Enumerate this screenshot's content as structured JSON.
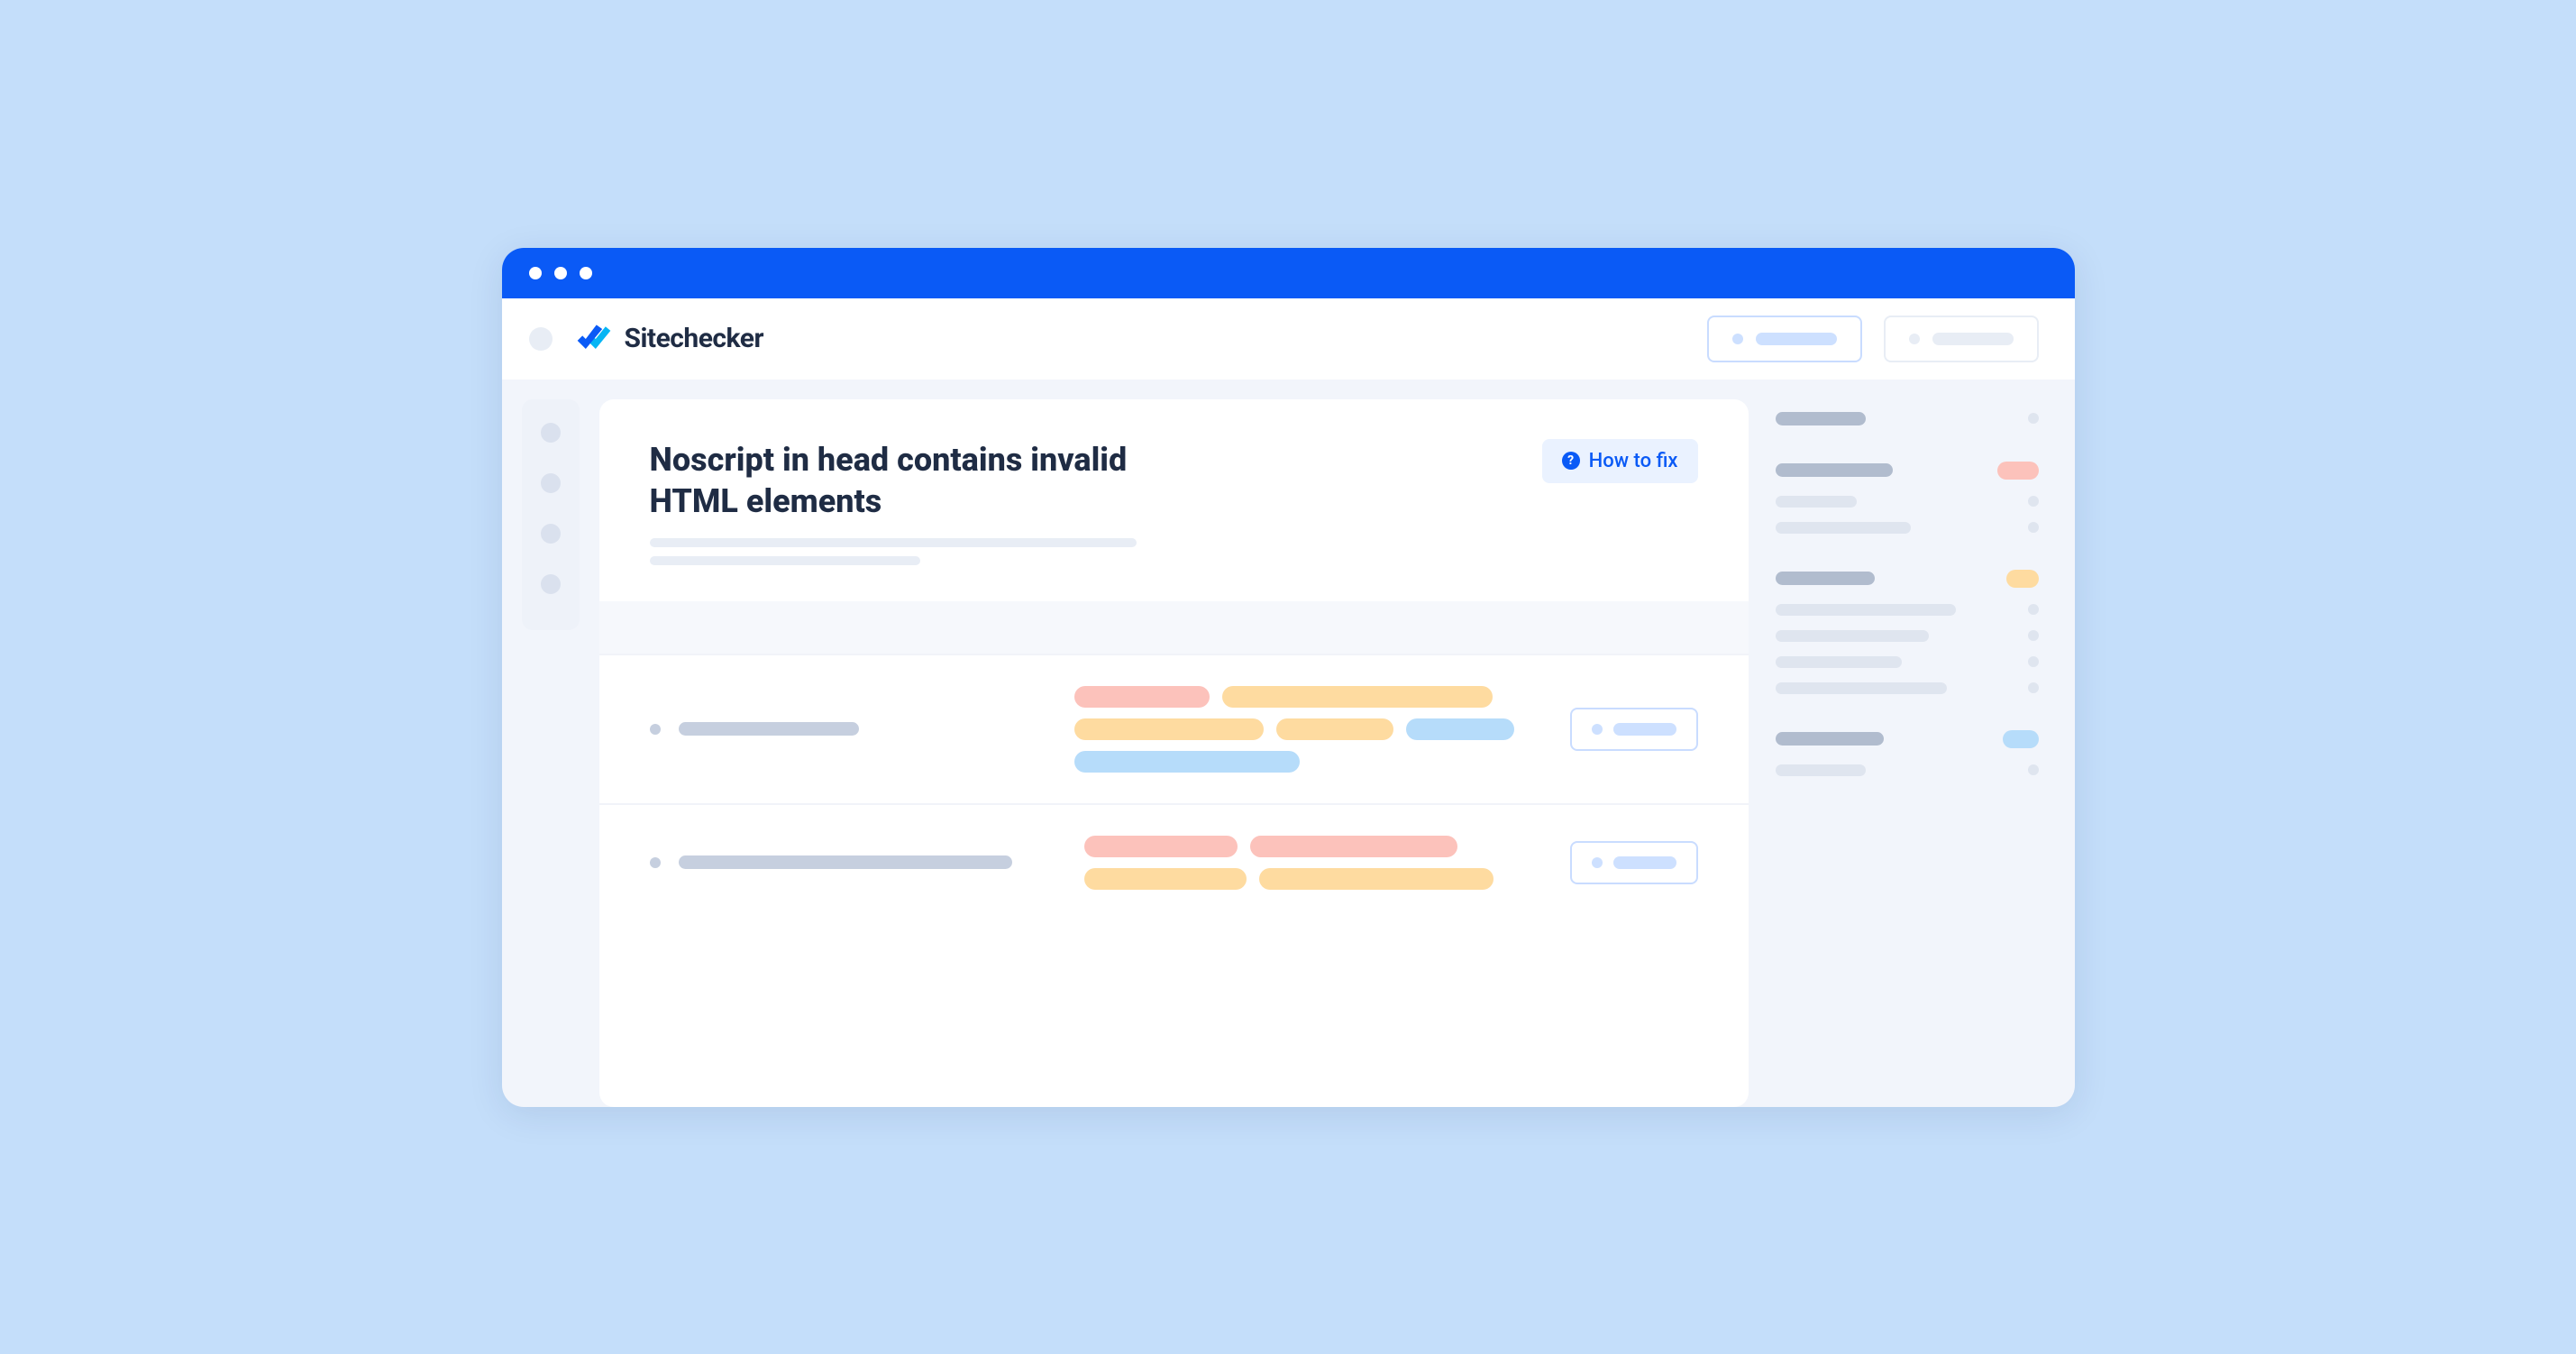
{
  "app": {
    "name": "Sitechecker"
  },
  "issue": {
    "title": "Noscript in head contains invalid HTML elements",
    "how_to_fix_label": "How to fix"
  }
}
